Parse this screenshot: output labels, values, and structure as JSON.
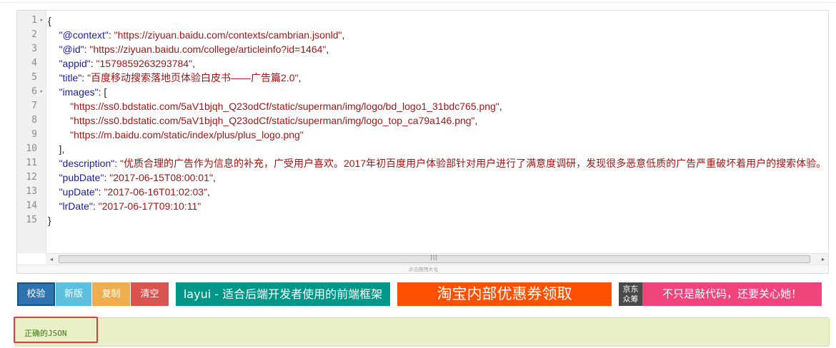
{
  "editor": {
    "line_numbers": [
      "1",
      "2",
      "3",
      "4",
      "5",
      "6",
      "7",
      "8",
      "9",
      "10",
      "11",
      "12",
      "13",
      "14",
      "15"
    ],
    "fold_markers": [
      "▾",
      "",
      "",
      "",
      "",
      "▾",
      "",
      "",
      "",
      "",
      "",
      "",
      "",
      "",
      ""
    ],
    "lines": [
      [
        {
          "t": "p",
          "v": "{"
        }
      ],
      [
        {
          "t": "p",
          "v": "    "
        },
        {
          "t": "k",
          "v": "\"@context\""
        },
        {
          "t": "p",
          "v": ": "
        },
        {
          "t": "s",
          "v": "\"https://ziyuan.baidu.com/contexts/cambrian.jsonld\""
        },
        {
          "t": "p",
          "v": ","
        }
      ],
      [
        {
          "t": "p",
          "v": "    "
        },
        {
          "t": "k",
          "v": "\"@id\""
        },
        {
          "t": "p",
          "v": ": "
        },
        {
          "t": "s",
          "v": "\"https://ziyuan.baidu.com/college/articleinfo?id=1464\""
        },
        {
          "t": "p",
          "v": ","
        }
      ],
      [
        {
          "t": "p",
          "v": "    "
        },
        {
          "t": "k",
          "v": "\"appid\""
        },
        {
          "t": "p",
          "v": ": "
        },
        {
          "t": "s",
          "v": "\"1579859263293784\""
        },
        {
          "t": "p",
          "v": ","
        }
      ],
      [
        {
          "t": "p",
          "v": "    "
        },
        {
          "t": "k",
          "v": "\"title\""
        },
        {
          "t": "p",
          "v": ": "
        },
        {
          "t": "s",
          "v": "\"百度移动搜索落地页体验白皮书——广告篇2.0\""
        },
        {
          "t": "p",
          "v": ","
        }
      ],
      [
        {
          "t": "p",
          "v": "    "
        },
        {
          "t": "k",
          "v": "\"images\""
        },
        {
          "t": "p",
          "v": ": ["
        }
      ],
      [
        {
          "t": "p",
          "v": "        "
        },
        {
          "t": "s",
          "v": "\"https://ss0.bdstatic.com/5aV1bjqh_Q23odCf/static/superman/img/logo/bd_logo1_31bdc765.png\""
        },
        {
          "t": "p",
          "v": ","
        }
      ],
      [
        {
          "t": "p",
          "v": "        "
        },
        {
          "t": "s",
          "v": "\"https://ss0.bdstatic.com/5aV1bjqh_Q23odCf/static/superman/img/logo_top_ca79a146.png\""
        },
        {
          "t": "p",
          "v": ","
        }
      ],
      [
        {
          "t": "p",
          "v": "        "
        },
        {
          "t": "s",
          "v": "\"https://m.baidu.com/static/index/plus/plus_logo.png\""
        }
      ],
      [
        {
          "t": "p",
          "v": "    ],"
        }
      ],
      [
        {
          "t": "p",
          "v": "    "
        },
        {
          "t": "k",
          "v": "\"description\""
        },
        {
          "t": "p",
          "v": ": "
        },
        {
          "t": "s",
          "v": "\"优质合理的广告作为信息的补充，广受用户喜欢。2017年初百度用户体验部针对用户进行了满意度调研，发现很多恶意低质的广告严重破坏着用户的搜索体验。"
        }
      ],
      [
        {
          "t": "p",
          "v": "    "
        },
        {
          "t": "k",
          "v": "\"pubDate\""
        },
        {
          "t": "p",
          "v": ": "
        },
        {
          "t": "s",
          "v": "\"2017-06-15T08:00:01\""
        },
        {
          "t": "p",
          "v": ","
        }
      ],
      [
        {
          "t": "p",
          "v": "    "
        },
        {
          "t": "k",
          "v": "\"upDate\""
        },
        {
          "t": "p",
          "v": ": "
        },
        {
          "t": "s",
          "v": "\"2017-06-16T01:02:03\""
        },
        {
          "t": "p",
          "v": ","
        }
      ],
      [
        {
          "t": "p",
          "v": "    "
        },
        {
          "t": "k",
          "v": "\"lrDate\""
        },
        {
          "t": "p",
          "v": ": "
        },
        {
          "t": "s",
          "v": "\"2017-06-17T09:10:11\""
        }
      ],
      [
        {
          "t": "p",
          "v": "}"
        }
      ]
    ],
    "scroll_left_arrow": "◂",
    "scroll_right_arrow": "▸",
    "scroll_grip": "|||",
    "resize_hint": "点击拖拽大化"
  },
  "toolbar": {
    "check_label": "校验",
    "new_label": "新版",
    "copy_label": "复制",
    "clear_label": "清空"
  },
  "ads": {
    "layui": "layui - 适合后端开发者使用的前端框架",
    "taobao": "淘宝内部优惠券领取",
    "jd_logo": "京东\n众筹",
    "jd_text": "不只是敲代码，还要关心她！"
  },
  "result": {
    "message": "正确的JSON"
  },
  "colors": {
    "key": "#1a1aa6",
    "string": "#a31515",
    "btn_check": "#2e73b0",
    "btn_new": "#5bc0de",
    "btn_copy": "#f0ad4e",
    "btn_clear": "#d9534f",
    "ad_layui": "#009688",
    "ad_taobao": "#ff5000",
    "ad_jd": "#f0457c",
    "result_bg": "#e9f0c8",
    "highlight": "#e23b3b"
  }
}
